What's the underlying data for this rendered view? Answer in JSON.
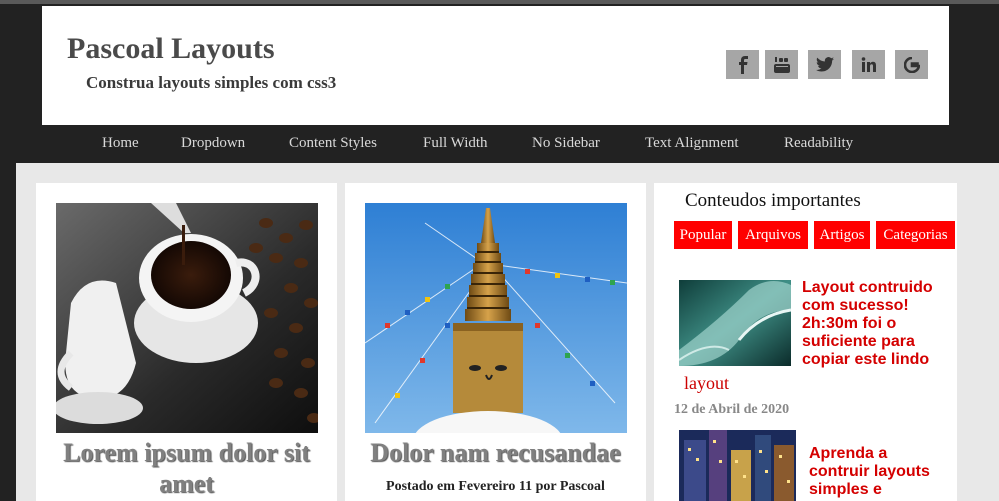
{
  "header": {
    "title": "Pascoal Layouts",
    "tagline": "Construa layouts simples com css3",
    "social": [
      {
        "icon": "facebook-icon",
        "glyph": "f"
      },
      {
        "icon": "youtube-icon",
        "glyph": "yt"
      },
      {
        "icon": "twitter-icon",
        "glyph": "tw"
      },
      {
        "icon": "linkedin-icon",
        "glyph": "in"
      },
      {
        "icon": "google-icon",
        "glyph": "G"
      }
    ]
  },
  "nav": {
    "items": [
      "Home",
      "Dropdown",
      "Content Styles",
      "Full Width",
      "No Sidebar",
      "Text Alignment",
      "Readability"
    ]
  },
  "cards": [
    {
      "title": "Lorem ipsum dolor sit amet",
      "image": "coffee-cup-photo"
    },
    {
      "title": "Dolor nam recusandae",
      "meta": "Postado em Fevereiro 11 por Pascoal",
      "image": "stupa-prayer-flags-photo"
    }
  ],
  "sidebar": {
    "title": "Conteudos importantes",
    "tabs": [
      "Popular",
      "Arquivos",
      "Artigos",
      "Categorias"
    ],
    "posts": [
      {
        "title": "Layout contruido com sucesso! 2h:30m foi o suficiente para copiar este lindo",
        "extra": "layout",
        "date": "12 de Abril de 2020",
        "image": "ocean-wave-photo"
      },
      {
        "title": "Aprenda a contruir layouts simples e",
        "image": "city-night-photo"
      }
    ]
  },
  "colors": {
    "accent": "#ff0000",
    "background": "#222222",
    "content_bg": "#e8e8e8",
    "social_bg": "#a6a6a6"
  }
}
